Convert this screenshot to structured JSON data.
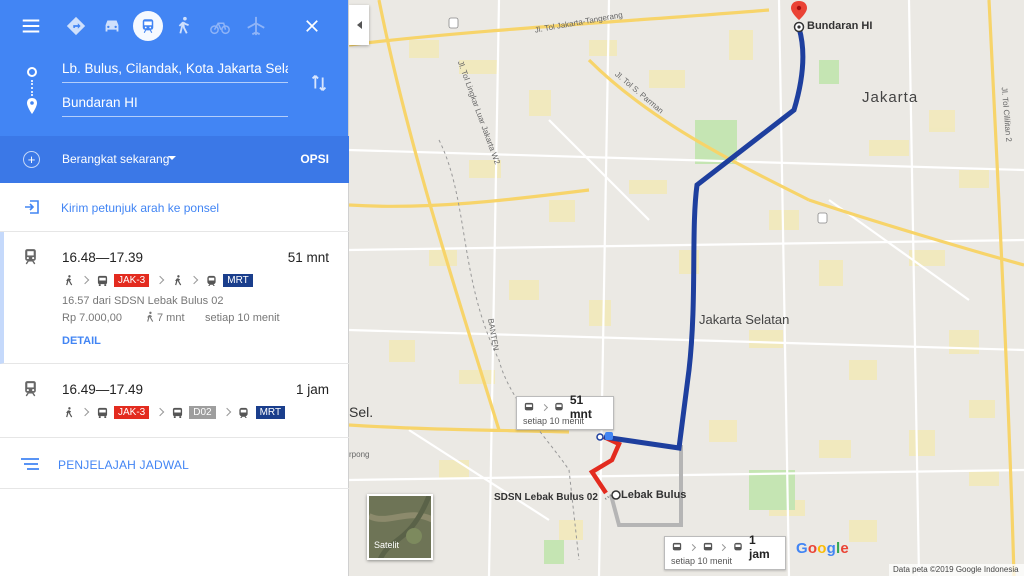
{
  "directions": {
    "origin": "Lb. Bulus, Cilandak, Kota Jakarta Selata",
    "destination": "Bundaran HI",
    "depart_label": "Berangkat sekarang",
    "options_label": "OPSI",
    "send_label": "Kirim petunjuk arah ke ponsel",
    "schedule_label": "PENJELAJAH JADWAL",
    "travel_modes": [
      "menu-icon",
      "directions-icon",
      "car-icon",
      "transit-icon",
      "walk-icon",
      "bike-icon",
      "flight-icon"
    ],
    "active_mode": "transit-icon"
  },
  "routes": [
    {
      "time": "16.48—17.39",
      "duration": "51 mnt",
      "steps": [
        {
          "type": "walk-icon"
        },
        {
          "type": "bus-icon",
          "badge": "JAK-3",
          "color": "#e32b1f"
        },
        {
          "type": "walk-icon"
        },
        {
          "type": "subway-icon",
          "badge": "MRT",
          "color": "#1a3e8c"
        }
      ],
      "from_text": "16.57 dari SDSN Lebak Bulus 02",
      "price": "Rp 7.000,00",
      "walk": "7 mnt",
      "frequency": "setiap 10 menit",
      "detail_label": "DETAIL"
    },
    {
      "time": "16.49—17.49",
      "duration": "1 jam",
      "steps": [
        {
          "type": "walk-icon"
        },
        {
          "type": "bus-icon",
          "badge": "JAK-3",
          "color": "#e32b1f"
        },
        {
          "type": "bus-icon",
          "badge": "D02",
          "color": "#9e9e9e"
        },
        {
          "type": "subway-icon",
          "badge": "MRT",
          "color": "#1a3e8c"
        }
      ]
    }
  ],
  "map": {
    "labels": {
      "jakarta": "Jakarta",
      "jakarta_selatan": "Jakarta Selatan",
      "sel": "Sel.",
      "destination": "Bundaran HI",
      "lebak_bulus": "Lebak Bulus",
      "sdsn": "SDSN Lebak Bulus 02"
    },
    "road_labels": {
      "tangerang": "Jl. Tol Jakarta-Tangerang",
      "lingkar": "Jl. Tol Lingkar Luar Jakarta W2",
      "parman": "Jl. Tol S. Parman",
      "cililitan": "Jl. Tol Cililitan 2",
      "banten": "BANTEN",
      "pong": "rpong"
    },
    "callouts": [
      {
        "duration": "51 mnt",
        "frequency": "setiap 10 menit"
      },
      {
        "duration": "1 jam",
        "frequency": "setiap 10 menit"
      }
    ],
    "satellite_label": "Satelit",
    "google_logo": [
      "G",
      "o",
      "o",
      "g",
      "l",
      "e"
    ],
    "attribution": "Data peta ©2019 Google   Indonesia",
    "route_colors": {
      "mrt": "#1e3f9e",
      "bus": "#e32b1f",
      "alt": "#b5b5b5"
    }
  }
}
